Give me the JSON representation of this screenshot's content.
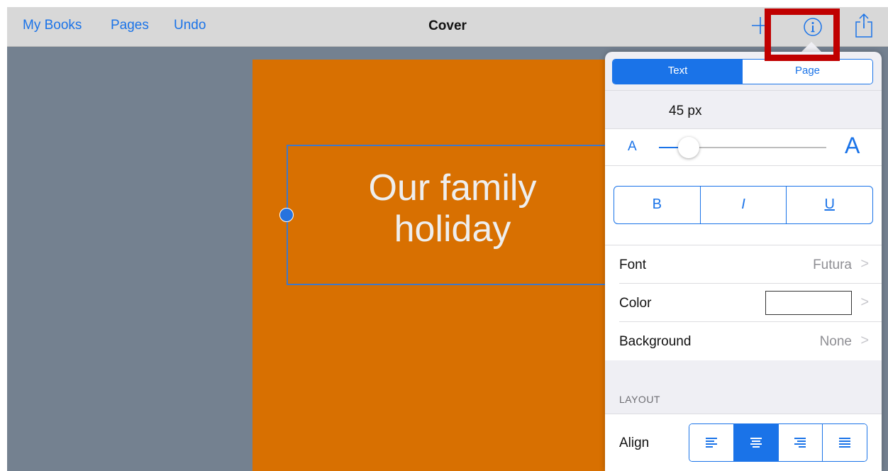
{
  "nav": {
    "my_books": "My Books",
    "pages": "Pages",
    "undo": "Undo",
    "title": "Cover",
    "add_icon": "plus-icon",
    "info_icon": "info-icon",
    "share_icon": "share-icon"
  },
  "cover": {
    "text_line1": "Our family",
    "text_line2": "holiday",
    "background_color": "#d87001"
  },
  "panel": {
    "tabs": [
      {
        "label": "Text",
        "active": true
      },
      {
        "label": "Page",
        "active": false
      }
    ],
    "size_label": "45 px",
    "slider": {
      "small_label": "A",
      "large_label": "A",
      "value_fraction": 0.18
    },
    "style_buttons": {
      "bold": "B",
      "italic": "I",
      "underline": "U"
    },
    "rows": {
      "font": {
        "label": "Font",
        "value": "Futura"
      },
      "color": {
        "label": "Color",
        "swatch": "#ffffff"
      },
      "background": {
        "label": "Background",
        "value": "None"
      }
    },
    "layout_header": "LAYOUT",
    "align_label": "Align",
    "align_options": [
      "align-left-icon",
      "align-center-icon",
      "align-right-icon",
      "align-justify-icon"
    ],
    "align_selected": 1
  },
  "colors": {
    "accent": "#1a73e8",
    "highlight": "#c00000",
    "workspace": "#748190"
  }
}
